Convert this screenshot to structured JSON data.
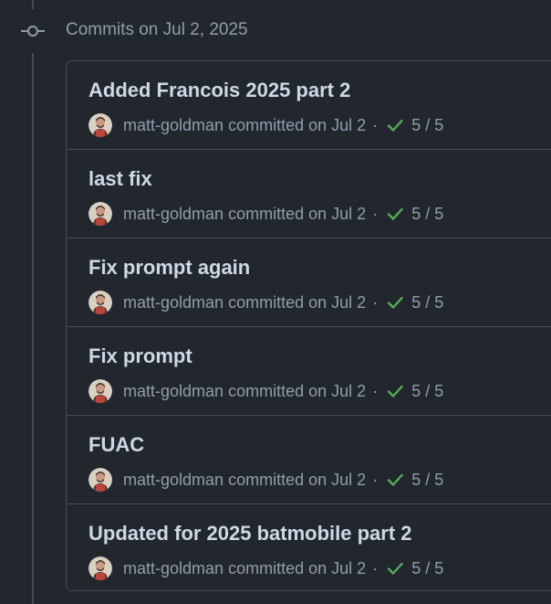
{
  "group": {
    "header": "Commits on Jul 2, 2025"
  },
  "commits": [
    {
      "title": "Added Francois 2025 part 2",
      "author": "matt-goldman",
      "action": "committed",
      "date": "on Jul 2",
      "separator": "·",
      "checks": "5 / 5"
    },
    {
      "title": "last fix",
      "author": "matt-goldman",
      "action": "committed",
      "date": "on Jul 2",
      "separator": "·",
      "checks": "5 / 5"
    },
    {
      "title": "Fix prompt again",
      "author": "matt-goldman",
      "action": "committed",
      "date": "on Jul 2",
      "separator": "·",
      "checks": "5 / 5"
    },
    {
      "title": "Fix prompt",
      "author": "matt-goldman",
      "action": "committed",
      "date": "on Jul 2",
      "separator": "·",
      "checks": "5 / 5"
    },
    {
      "title": "FUAC",
      "author": "matt-goldman",
      "action": "committed",
      "date": "on Jul 2",
      "separator": "·",
      "checks": "5 / 5"
    },
    {
      "title": "Updated for 2025 batmobile part 2",
      "author": "matt-goldman",
      "action": "committed",
      "date": "on Jul 2",
      "separator": "·",
      "checks": "5 / 5"
    }
  ],
  "icons": {
    "group": "git-commit-icon",
    "status": "check-icon",
    "avatar": "user-avatar"
  },
  "colors": {
    "background": "#22272e",
    "border": "#444c56",
    "title": "#cdd9e5",
    "muted": "#909dab",
    "success": "#57ab5a"
  }
}
